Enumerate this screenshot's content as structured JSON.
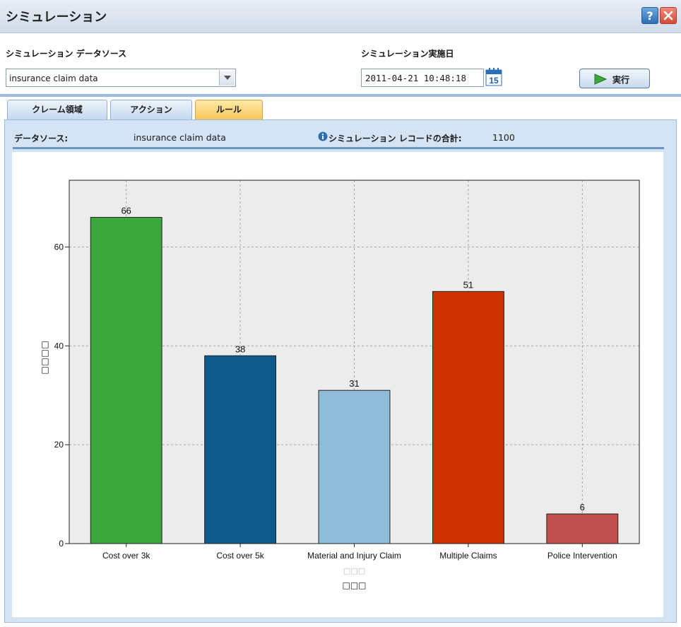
{
  "window": {
    "title": "シミュレーション"
  },
  "form": {
    "datasource_label": "シミュレーション データソース",
    "datasource_value": "insurance claim data",
    "date_label": "シミュレーション実施日",
    "date_value": "2011-04-21 10:48:18",
    "calendar_day": "15",
    "run_label": "実行"
  },
  "tabs": [
    {
      "label": "クレーム領域",
      "active": false
    },
    {
      "label": "アクション",
      "active": false
    },
    {
      "label": "ルール",
      "active": true
    }
  ],
  "info": {
    "datasource_label": "データソース:",
    "datasource_value": "insurance claim data",
    "total_label": "シミュレーション レコードの合計:",
    "total_value": "1100"
  },
  "chart_data": {
    "type": "bar",
    "categories": [
      "Cost over 3k",
      "Cost over 5k",
      "Material and Injury Claim",
      "Multiple Claims",
      "Police Intervention"
    ],
    "values": [
      66,
      38,
      31,
      51,
      6
    ],
    "colors": [
      "#3aa83a",
      "#0f5a8a",
      "#8fbcd6",
      "#cc3300",
      "#c0504d"
    ],
    "yticks": [
      0,
      20,
      40,
      60
    ],
    "ylim": [
      0,
      73.5
    ],
    "xlabel_lines": [
      "□□□",
      "□□□"
    ],
    "ylabel": "□□□□",
    "grid": true,
    "plot_background": "#ececec"
  }
}
